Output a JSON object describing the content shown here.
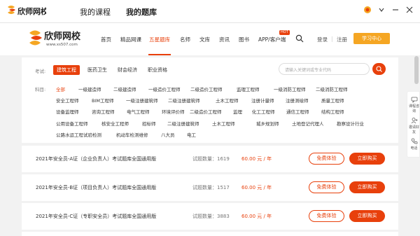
{
  "titlebar": {
    "logo_text": "欣师网校",
    "tabs": [
      "我的课程",
      "我的题库"
    ]
  },
  "nav": {
    "logo_text": "欣师网校",
    "logo_url": "www.xs507.com",
    "items": [
      "首页",
      "精品网课",
      "五星题库",
      "名师",
      "文库",
      "资讯",
      "图书",
      "APP/客户端"
    ],
    "active_item": "五星题库",
    "hot_badge": "HOT",
    "login": "登录",
    "separator": "|",
    "register": "注册",
    "study_center": "学习中心"
  },
  "filter": {
    "exam_label": "考试:",
    "categories": [
      "建筑工程",
      "医药卫生",
      "财会经济",
      "职业资格"
    ],
    "active_category": "建筑工程",
    "search_placeholder": "请输入关键词或专业代码",
    "subject_label": "科目:",
    "subject_rows": [
      [
        "全部",
        "一级建造师",
        "二级建造师",
        "一级造价工程师",
        "二级造价工程师",
        "监理工程师",
        "一级消防工程师",
        "二级消防工程师"
      ],
      [
        "安全工程师",
        "BIM工程师",
        "一级注册建筑师",
        "二级注册建筑师",
        "土木工程师",
        "注册计量师",
        "注册测绘师",
        "质量工程师"
      ],
      [
        "设备监理师",
        "咨询工程师",
        "电气工程师",
        "环境评价师",
        "二级造价工程师",
        "监理",
        "化工工程师",
        "通信工程师",
        "结构工程师"
      ],
      [
        "公用设备工程师",
        "核安全工程师",
        "招标师",
        "二级注册建筑师",
        "土木工程师",
        "城乡规划师",
        "土地登记代理人",
        "勘察设计行业"
      ],
      [
        "公路水运工程试验检测",
        "机动车检测维修",
        "八大员",
        "电工"
      ]
    ]
  },
  "rows": [
    {
      "title": "2021年安全员-A证（企业负责人）考试题库全国通用版",
      "count": "试题数量：1619",
      "price": "60.00 元 / 年",
      "free": "免费体验",
      "buy": "立即购买"
    },
    {
      "title": "2021年安全员-B证（项目负责人）考试题库全国通用版",
      "count": "试题数量：1517",
      "price": "60.00 元 / 年",
      "free": "免费体验",
      "buy": "立即购买"
    },
    {
      "title": "2021年安全员-C证（专职安全员）考试题库全国通用版",
      "count": "试题数量：3883",
      "price": "60.00 元 / 年",
      "free": "免费体验",
      "buy": "立即购买"
    }
  ],
  "sidefloat": [
    "课程咨询",
    "邀请好友",
    "电话"
  ],
  "colors": {
    "accent": "#e8400c",
    "study_btn": "#f5a623"
  }
}
